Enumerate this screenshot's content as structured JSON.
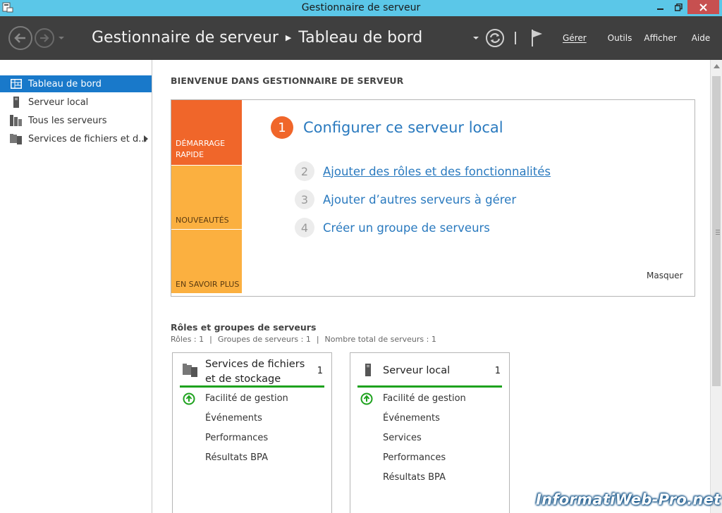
{
  "window": {
    "title": "Gestionnaire de serveur"
  },
  "header": {
    "breadcrumb": [
      "Gestionnaire de serveur",
      "Tableau de bord"
    ],
    "menu": [
      "Gérer",
      "Outils",
      "Afficher",
      "Aide"
    ],
    "menu_colors": {
      "bg": "#3f3f3f",
      "text": "#f2f2f2"
    }
  },
  "sidebar": {
    "items": [
      {
        "label": "Tableau de bord",
        "icon": "dashboard-icon",
        "active": true
      },
      {
        "label": "Serveur local",
        "icon": "server-icon",
        "active": false
      },
      {
        "label": "Tous les serveurs",
        "icon": "servers-icon",
        "active": false
      },
      {
        "label": "Services de fichiers et d...",
        "icon": "file-services-icon",
        "active": false
      }
    ]
  },
  "main": {
    "welcome": "BIENVENUE DANS GESTIONNAIRE DE SERVEUR",
    "quickstart": {
      "tabs": [
        "DÉMARRAGE RAPIDE",
        "NOUVEAUTÉS",
        "EN SAVOIR PLUS"
      ],
      "steps": [
        {
          "num": "1",
          "label": "Configurer ce serveur local"
        },
        {
          "num": "2",
          "label": "Ajouter des rôles et des fonctionnalités"
        },
        {
          "num": "3",
          "label": "Ajouter d’autres serveurs à gérer"
        },
        {
          "num": "4",
          "label": "Créer un groupe de serveurs"
        }
      ],
      "hide": "Masquer"
    },
    "roles": {
      "title": "Rôles et groupes de serveurs",
      "counts": [
        "Rôles : 1",
        "Groupes de serveurs : 1",
        "Nombre total de serveurs : 1"
      ]
    },
    "cards": [
      {
        "title": "Services de fichiers et de stockage",
        "count": "1",
        "rows": [
          "Facilité de gestion",
          "Événements",
          "Performances",
          "Résultats BPA"
        ]
      },
      {
        "title": "Serveur local",
        "count": "1",
        "rows": [
          "Facilité de gestion",
          "Événements",
          "Services",
          "Performances",
          "Résultats BPA"
        ]
      }
    ]
  },
  "colors": {
    "titlebar": "#5bc7e8",
    "accent_orange": "#f0662a",
    "accent_amber": "#fbb040",
    "link_blue": "#2a7abf",
    "status_green": "#1ea21e",
    "sidebar_active": "#1979ca"
  },
  "watermark": "InformatiWeb-Pro.net"
}
